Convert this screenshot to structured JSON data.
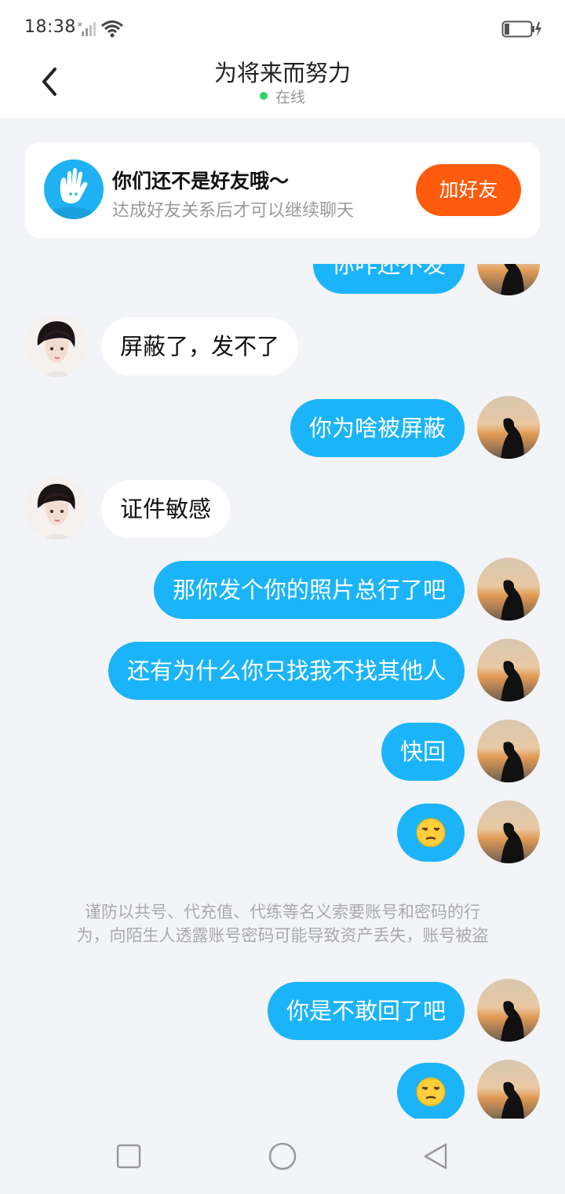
{
  "status_bar": {
    "time": "18:38",
    "icons": [
      "signal-icon",
      "wifi-icon",
      "battery-charging-icon"
    ]
  },
  "header": {
    "title": "为将来而努力",
    "status": "在线",
    "status_color": "#2bd55e"
  },
  "notice": {
    "title": "你们还不是好友哦～",
    "subtitle": "达成好友关系后才可以继续聊天",
    "button": "加好友",
    "button_color": "#ff5b0c"
  },
  "messages": [
    {
      "from": "me",
      "text": "你咋还不发"
    },
    {
      "from": "other",
      "text": "屏蔽了，发不了"
    },
    {
      "from": "me",
      "text": "你为啥被屏蔽"
    },
    {
      "from": "other",
      "text": "证件敏感"
    },
    {
      "from": "me",
      "text": "那你发个你的照片总行了吧"
    },
    {
      "from": "me",
      "text": "还有为什么你只找我不找其他人"
    },
    {
      "from": "me",
      "text": "快回"
    },
    {
      "from": "me",
      "emoji": "unamused-face-icon"
    },
    {
      "from": "me",
      "text": "你是不敢回了吧"
    },
    {
      "from": "me",
      "emoji": "unamused-face-icon"
    }
  ],
  "warning_lines": [
    "谨防以共号、代充值、代练等名义索要账号和密码的行",
    "为，向陌生人透露账号密码可能导致资产丢失，账号被盗"
  ],
  "colors": {
    "my_bubble": "#1cb4f8",
    "other_bubble": "#ffffff",
    "background": "#f2f4f7"
  },
  "nav_bar": [
    "recent-apps-button",
    "home-button",
    "back-button"
  ]
}
